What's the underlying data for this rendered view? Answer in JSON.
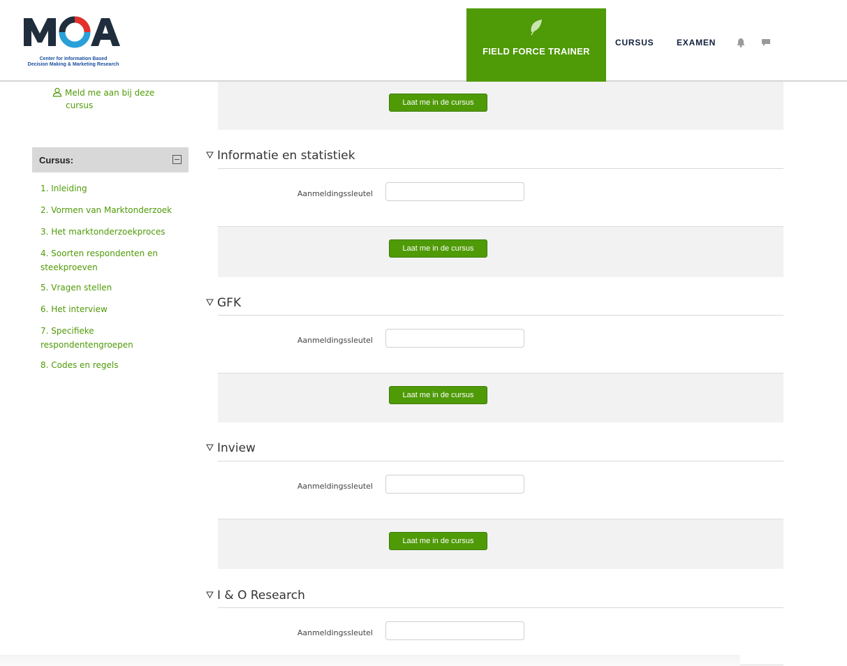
{
  "header": {
    "logo_text": "MOA",
    "logo_line1": "Center for Information Based",
    "logo_line2": "Decision Making & Marketing Research",
    "brand": "FIELD FORCE TRAINER",
    "nav_cursus": "CURSUS",
    "nav_examen": "EXAMEN",
    "icons": [
      "leaf-icon",
      "bell-icon",
      "chat-icon"
    ]
  },
  "sidebar": {
    "enrol_link_line1": "Meld me aan bij deze",
    "enrol_link_line2": "cursus",
    "block_title": "Cursus:",
    "items": [
      "1. Inleiding",
      "2. Vormen van Marktonderzoek",
      "3. Het marktonderzoekproces",
      "4. Soorten respondenten en steekproeven",
      "5. Vragen stellen",
      "6. Het interview",
      "7. Specifieke respondentengroepen",
      "8. Codes en regels"
    ]
  },
  "main": {
    "top_button": "Laat me in de cursus",
    "sections": [
      {
        "title": "Informatie en statistiek",
        "label": "Aanmeldingssleutel",
        "value": "",
        "button": "Laat me in de cursus"
      },
      {
        "title": "GFK",
        "label": "Aanmeldingssleutel",
        "value": "",
        "button": "Laat me in de cursus"
      },
      {
        "title": "Inview",
        "label": "Aanmeldingssleutel",
        "value": "",
        "button": "Laat me in de cursus"
      },
      {
        "title": "I & O Research",
        "label": "Aanmeldingssleutel",
        "value": ""
      }
    ]
  },
  "colors": {
    "accent_green": "#4f9a07",
    "nav_text": "#0f1f3b",
    "logo_blue": "#1a4fa0"
  }
}
